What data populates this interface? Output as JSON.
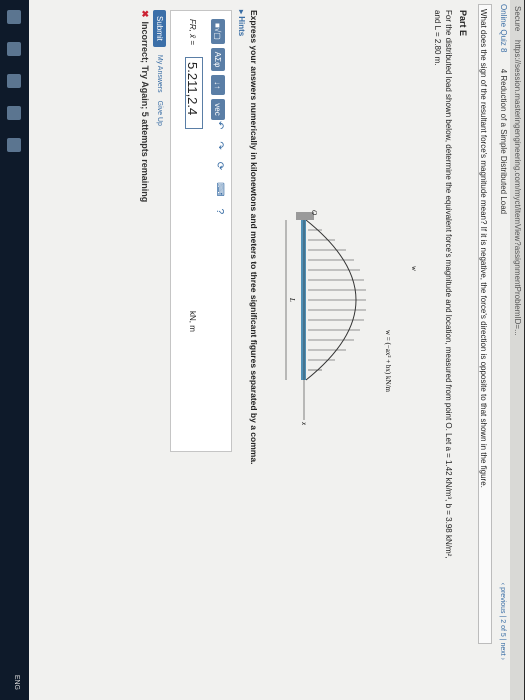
{
  "browser": {
    "secure": "Secure",
    "url": "https://session.masteringengineering.com/myct/itemView?assignmentProblemID=..."
  },
  "breadcrumb": {
    "course": "Online Quiz 8",
    "assignment": "4 Reduction of a Simple Distributed Load"
  },
  "pager": {
    "previous": "‹ previous",
    "count": " | 2 of 5 | ",
    "next": "next ›"
  },
  "question_bar": "What does the sign of the resultant force's magnitude mean? If it is negative, the force's direction is opposite to that shown in the figure.",
  "part": {
    "label": "Part E",
    "prompt": "For the distributed load shown below, determine the equivalent force's magnitude and location, measured from point O. Let a = 1.42 kN/m³, b = 3.98 kN/m²,",
    "length": "and L = 2.80 m."
  },
  "figure": {
    "w_label": "w",
    "equation": "w = (−ax² + bx) kN/m",
    "x_label": "x",
    "origin_label": "O",
    "L_label": "L"
  },
  "instructions": "Express your answers numerically in kilonewtons and meters to three significant figures separated by a comma.",
  "hints_label": "▸ Hints",
  "toolbar": [
    "■√▢",
    "ΑΣφ",
    "↓↑",
    "vec"
  ],
  "answer": {
    "label": "FR, x̄ =",
    "value": "5.211,2.4",
    "units": "kN, m"
  },
  "actions": {
    "submit": "Submit",
    "my_answers": "My Answers",
    "give_up": "Give Up"
  },
  "feedback": "Incorrect; Try Again; 5 attempts remaining",
  "taskbar": {
    "tray_lang": "ENG"
  }
}
